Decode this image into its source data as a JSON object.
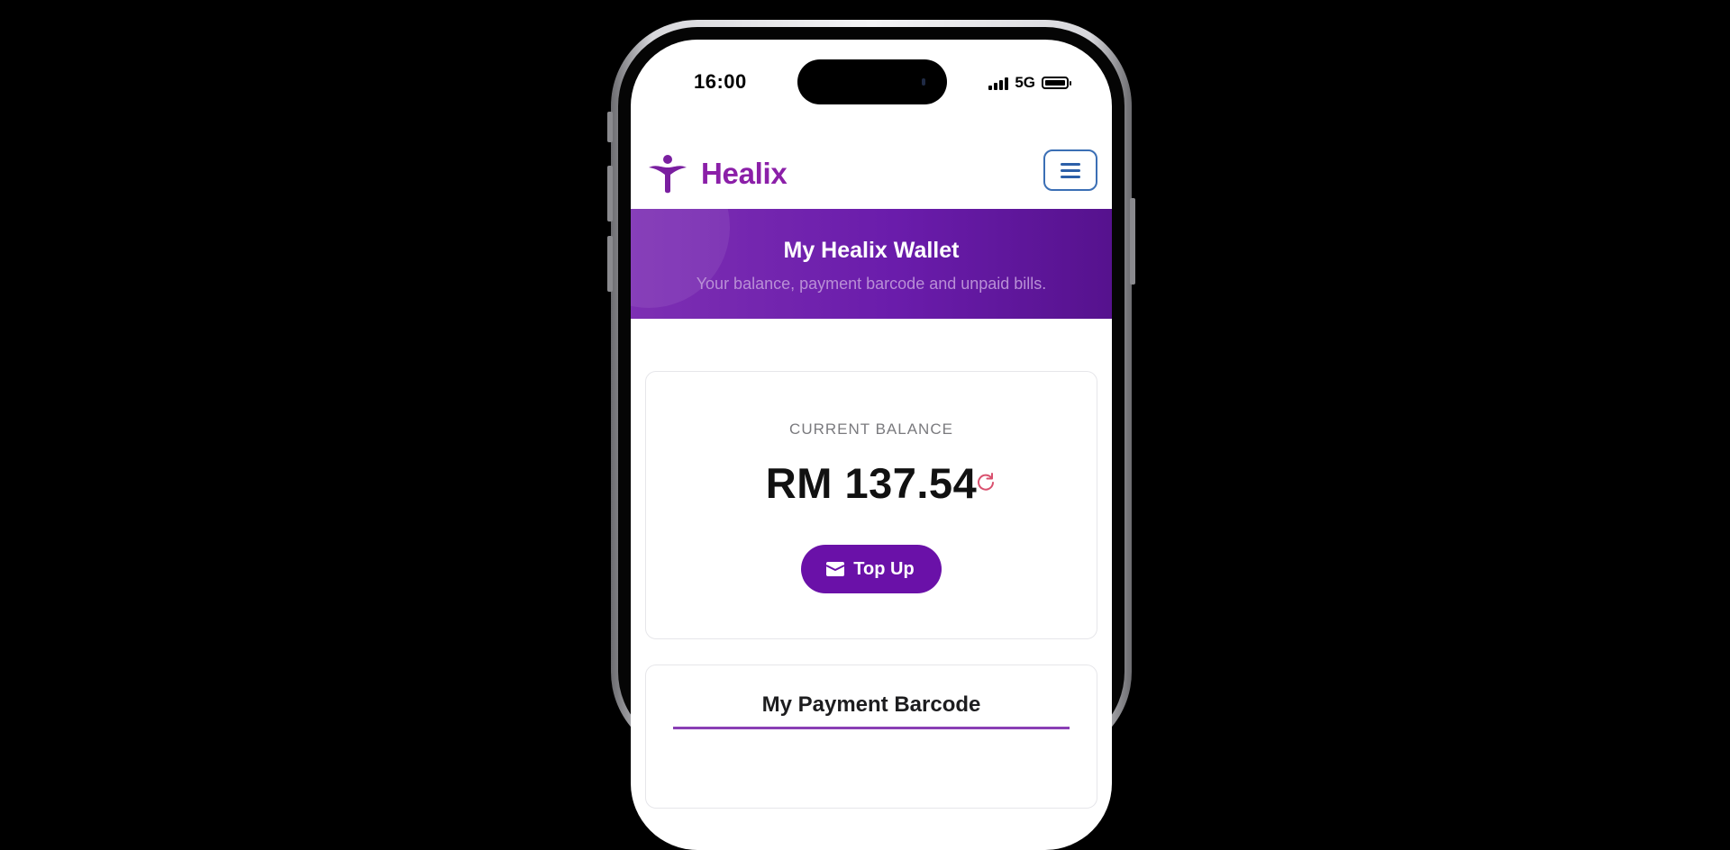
{
  "status_bar": {
    "time": "16:00",
    "network": "5G",
    "battery_level": 1.0
  },
  "header": {
    "brand": "Healix",
    "logo_icon": "person-arms-raised-logo",
    "menu_icon": "hamburger-menu-icon"
  },
  "banner": {
    "title": "My Healix Wallet",
    "subtitle": "Your balance, payment barcode and unpaid bills."
  },
  "balance": {
    "label": "CURRENT BALANCE",
    "amount": "RM 137.54",
    "refresh_icon": "refresh-icon",
    "topup_label": "Top Up",
    "topup_icon": "wallet-icon"
  },
  "barcode": {
    "title": "My Payment Barcode"
  },
  "colors": {
    "brand_purple": "#8b1fa8",
    "banner_purple": "#6a1cab",
    "button_purple": "#6a11a8",
    "refresh_pink": "#d9506e",
    "menu_blue": "#2c5fa8"
  }
}
